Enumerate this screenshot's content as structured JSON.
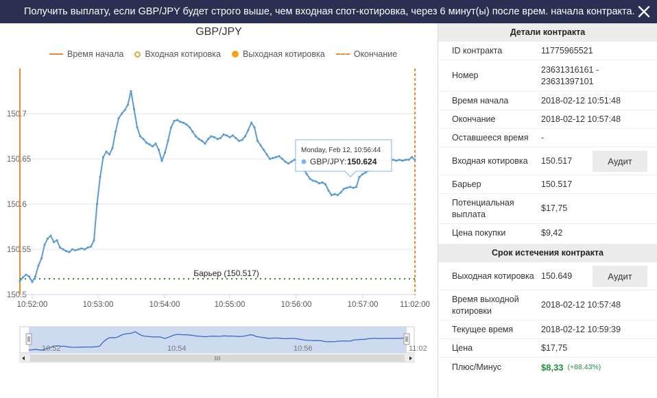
{
  "header": {
    "message": "Получить выплату, если GBP/JPY будет строго выше, чем входная спот-котировка, через 6 минут(ы) после врем. начала контракта."
  },
  "chart": {
    "title": "GBP/JPY",
    "legend": {
      "start": "Время начала",
      "entry": "Входная котировка",
      "exit": "Выходная котировка",
      "end": "Окончание"
    },
    "barrier_label": "Барьер (150.517)",
    "tooltip": {
      "date": "Monday, Feb 12, 10:56:44",
      "series": "GBP/JPY:",
      "value": "150.624"
    },
    "navigator": {
      "ticks": [
        "10:52",
        "10:54",
        "10:56",
        "11:02"
      ]
    }
  },
  "chart_data": {
    "type": "line",
    "series": [
      {
        "name": "GBP/JPY"
      }
    ],
    "x_tick_labels": [
      "10:52:00",
      "10:53:00",
      "10:54:00",
      "10:55:00",
      "10:56:00",
      "10:57:00",
      "11:02:00"
    ],
    "y_tick_labels": [
      "150.5",
      "150.55",
      "150.6",
      "150.65",
      "150.7"
    ],
    "ylim": [
      150.5,
      150.75
    ],
    "x_start": "10:51:48",
    "x_end": "10:57:48",
    "barrier": 150.517,
    "points": [
      [
        0,
        150.515
      ],
      [
        2,
        150.519
      ],
      [
        4,
        150.522
      ],
      [
        6,
        150.52
      ],
      [
        8,
        150.514
      ],
      [
        10,
        150.52
      ],
      [
        12,
        150.532
      ],
      [
        14,
        150.54
      ],
      [
        16,
        150.555
      ],
      [
        18,
        150.562
      ],
      [
        20,
        150.565
      ],
      [
        22,
        150.558
      ],
      [
        24,
        150.56
      ],
      [
        26,
        150.552
      ],
      [
        28,
        150.55
      ],
      [
        30,
        150.548
      ],
      [
        32,
        150.547
      ],
      [
        34,
        150.55
      ],
      [
        36,
        150.549
      ],
      [
        38,
        150.55
      ],
      [
        40,
        150.551
      ],
      [
        42,
        150.55
      ],
      [
        44,
        150.552
      ],
      [
        46,
        150.553
      ],
      [
        48,
        150.56
      ],
      [
        50,
        150.6
      ],
      [
        52,
        150.63
      ],
      [
        54,
        150.652
      ],
      [
        56,
        150.658
      ],
      [
        58,
        150.655
      ],
      [
        60,
        150.662
      ],
      [
        62,
        150.68
      ],
      [
        64,
        150.695
      ],
      [
        66,
        150.7
      ],
      [
        68,
        150.704
      ],
      [
        70,
        150.71
      ],
      [
        72,
        150.725
      ],
      [
        74,
        150.705
      ],
      [
        76,
        150.685
      ],
      [
        78,
        150.675
      ],
      [
        80,
        150.672
      ],
      [
        82,
        150.668
      ],
      [
        84,
        150.666
      ],
      [
        86,
        150.664
      ],
      [
        88,
        150.667
      ],
      [
        90,
        150.66
      ],
      [
        92,
        150.648
      ],
      [
        94,
        150.657
      ],
      [
        96,
        150.67
      ],
      [
        98,
        150.685
      ],
      [
        100,
        150.692
      ],
      [
        102,
        150.693
      ],
      [
        104,
        150.691
      ],
      [
        106,
        150.69
      ],
      [
        108,
        150.688
      ],
      [
        110,
        150.685
      ],
      [
        112,
        150.68
      ],
      [
        114,
        150.675
      ],
      [
        116,
        150.672
      ],
      [
        118,
        150.67
      ],
      [
        120,
        150.667
      ],
      [
        122,
        150.672
      ],
      [
        124,
        150.675
      ],
      [
        126,
        150.674
      ],
      [
        128,
        150.672
      ],
      [
        130,
        150.673
      ],
      [
        132,
        150.677
      ],
      [
        134,
        150.676
      ],
      [
        136,
        150.674
      ],
      [
        138,
        150.676
      ],
      [
        140,
        150.673
      ],
      [
        142,
        150.67
      ],
      [
        144,
        150.671
      ],
      [
        146,
        150.675
      ],
      [
        148,
        150.682
      ],
      [
        150,
        150.69
      ],
      [
        152,
        150.685
      ],
      [
        154,
        150.67
      ],
      [
        156,
        150.665
      ],
      [
        158,
        150.66
      ],
      [
        160,
        150.655
      ],
      [
        162,
        150.65
      ],
      [
        164,
        150.651
      ],
      [
        166,
        150.652
      ],
      [
        168,
        150.653
      ],
      [
        170,
        150.65
      ],
      [
        172,
        150.647
      ],
      [
        174,
        150.645
      ],
      [
        176,
        150.647
      ],
      [
        178,
        150.649
      ],
      [
        180,
        150.648
      ],
      [
        182,
        150.643
      ],
      [
        184,
        150.638
      ],
      [
        186,
        150.633
      ],
      [
        188,
        150.628
      ],
      [
        190,
        150.626
      ],
      [
        192,
        150.625
      ],
      [
        194,
        150.623
      ],
      [
        196,
        150.624
      ],
      [
        198,
        150.622
      ],
      [
        200,
        150.615
      ],
      [
        202,
        150.61
      ],
      [
        204,
        150.611
      ],
      [
        206,
        150.61
      ],
      [
        208,
        150.613
      ],
      [
        210,
        150.617
      ],
      [
        212,
        150.618
      ],
      [
        214,
        150.619
      ],
      [
        216,
        150.618
      ],
      [
        218,
        150.619
      ],
      [
        220,
        150.63
      ],
      [
        222,
        150.633
      ],
      [
        224,
        150.635
      ],
      [
        226,
        150.637
      ],
      [
        228,
        150.638
      ],
      [
        230,
        150.645
      ],
      [
        232,
        150.648
      ],
      [
        234,
        150.649
      ],
      [
        236,
        150.648
      ],
      [
        238,
        150.647
      ],
      [
        240,
        150.648
      ],
      [
        242,
        150.649
      ],
      [
        244,
        150.648
      ],
      [
        246,
        150.649
      ],
      [
        248,
        150.648
      ],
      [
        250,
        150.649
      ],
      [
        252,
        150.649
      ],
      [
        254,
        150.652
      ],
      [
        256,
        150.649
      ]
    ]
  },
  "details": {
    "section1_title": "Детали контракта",
    "section2_title": "Срок истечения контракта",
    "audit_label": "Аудит",
    "rows": [
      {
        "label": "ID контракта",
        "value": "11775965521"
      },
      {
        "label": "Номер",
        "value": "23631316161 - 23631397101"
      },
      {
        "label": "Время начала",
        "value": "2018-02-12 10:51:48"
      },
      {
        "label": "Окончание",
        "value": "2018-02-12 10:57:48"
      },
      {
        "label": "Оставшееся время",
        "value": "-"
      },
      {
        "label": "Входная котировка",
        "value": "150.517"
      },
      {
        "label": "Барьер",
        "value": "150.517"
      },
      {
        "label": "Потенциальная выплата",
        "value": "$17,75"
      },
      {
        "label": "Цена покупки",
        "value": "$9,42"
      }
    ],
    "rows2": [
      {
        "label": "Выходная котировка",
        "value": "150.649"
      },
      {
        "label": "Время выходной котировки",
        "value": "2018-02-12 10:57:48"
      },
      {
        "label": "Текущее время",
        "value": "2018-02-12 10:59:39"
      },
      {
        "label": "Цена",
        "value": "$17,75"
      },
      {
        "label": "Плюс/Минус",
        "value": "$8,33",
        "pct": "(+88.43%)"
      }
    ]
  },
  "colors": {
    "header_bg": "#2a3052",
    "line": "#5b9bd5",
    "marker_orange": "#e98a2f",
    "barrier_green": "#1a8f2d",
    "profit_green": "#1f8f3c"
  }
}
